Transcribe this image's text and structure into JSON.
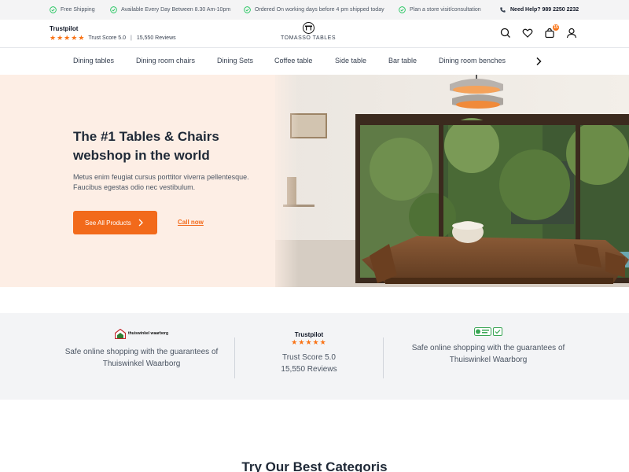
{
  "topbar": {
    "items": [
      "Free Shipping",
      "Available Every Day Between 8.30 Am-10pm",
      "Ordered On working days before 4 pm shipped today",
      "Plan a store visit/consultation"
    ],
    "help": "Need Help? 989 2250 2232"
  },
  "header": {
    "trustpilot_title": "Trustpilot",
    "trust_score": "Trust Score 5.0",
    "separator": "|",
    "reviews": "15,550 Reviews",
    "logo_text": "TOMASSO TABLES",
    "cart_count": "15"
  },
  "nav": {
    "categories": [
      "Dining tables",
      "Dining room chairs",
      "Dining Sets",
      "Coffee table",
      "Side table",
      "Bar table",
      "Dining room benches"
    ]
  },
  "hero": {
    "title": "The #1 Tables & Chairs webshop in the world",
    "subtitle": "Metus enim feugiat cursus porttitor viverra pellentesque. Faucibus egestas odio nec vestibulum.",
    "primary_button": "See All Products",
    "secondary_link": "Call now"
  },
  "trust": {
    "col1_logo": "thuiswinkel waarborg",
    "col1_text": "Safe online shopping with the guarantees of Thuiswinkel Waarborg",
    "col2_title": "Trustpilot",
    "col2_score": "Trust Score 5.0",
    "col2_reviews": "15,550 Reviews",
    "col3_text": "Safe online shopping with the guarantees of Thuiswinkel Waarborg"
  },
  "categories_section": {
    "title": "Try Our Best Categoris"
  },
  "colors": {
    "accent": "#f26a1b",
    "star": "#f97316",
    "check": "#22c55e",
    "hero_bg": "#fdeee5",
    "trust_bg": "#f3f4f6"
  },
  "icons": [
    "check-icon",
    "phone-icon",
    "search-icon",
    "heart-icon",
    "cart-icon",
    "user-icon",
    "chevron-right-icon",
    "star-icon"
  ]
}
